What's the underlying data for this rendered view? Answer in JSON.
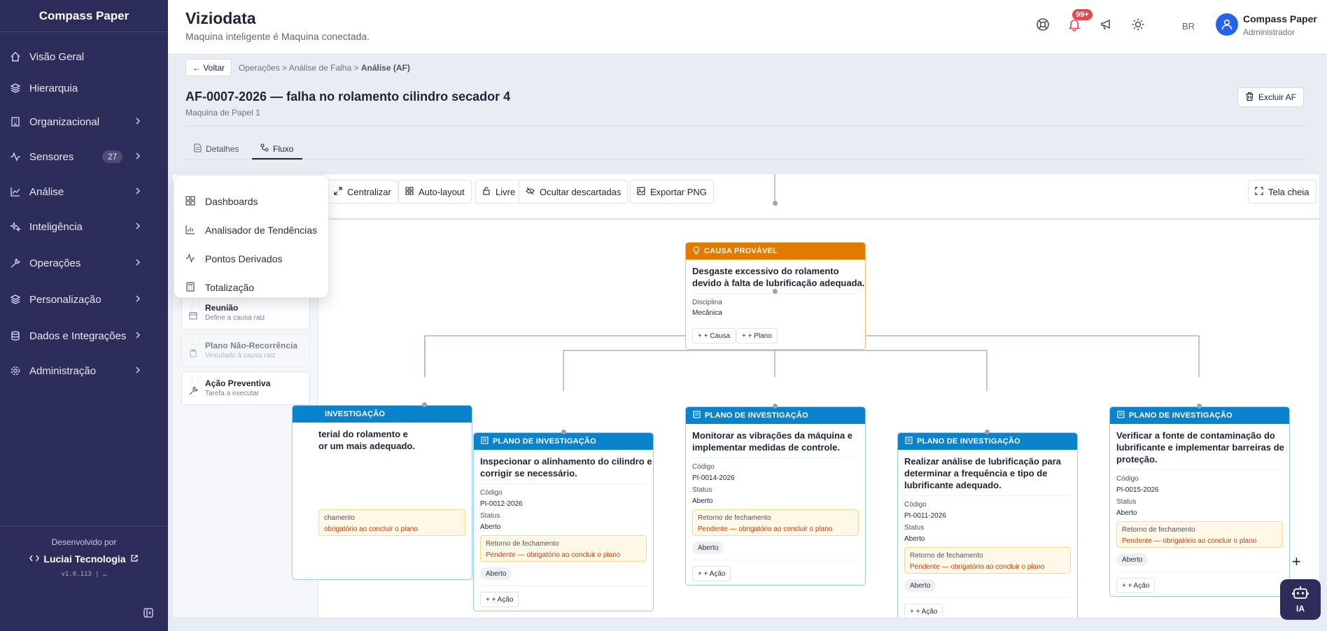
{
  "sidebar": {
    "brand": "Compass Paper",
    "items": [
      {
        "label": "Visão Geral",
        "icon": "home-icon"
      },
      {
        "label": "Hierarquia",
        "icon": "layers-icon"
      },
      {
        "label": "Organizacional",
        "icon": "building-icon"
      },
      {
        "label": "Sensores",
        "icon": "activity-icon",
        "badge": "27"
      },
      {
        "label": "Análise",
        "icon": "chart-icon"
      },
      {
        "label": "Inteligência",
        "icon": "sparkles-icon"
      },
      {
        "label": "Operações",
        "icon": "wrench-icon"
      },
      {
        "label": "Personalização",
        "icon": "layers-icon"
      },
      {
        "label": "Dados e Integrações",
        "icon": "database-icon"
      },
      {
        "label": "Administração",
        "icon": "gear-icon"
      }
    ],
    "footer": {
      "developed_by": "Desenvolvido por",
      "company": "Luciai Tecnologia",
      "version": "v1.0.113 | …"
    }
  },
  "header": {
    "title": "Viziodata",
    "subtitle": "Maquina inteligente é Maquina conectada.",
    "notifications_badge": "99+",
    "language": "BR",
    "user_name": "Compass Paper",
    "user_role": "Administrador"
  },
  "page": {
    "back_label": "← Voltar",
    "breadcrumb": {
      "part1": "Operações",
      "sep1": ">",
      "part2": "Análise de Falha",
      "sep2": ">",
      "current": "Análise (AF)"
    },
    "title": "AF-0007-2026 — falha no rolamento cilindro secador 4",
    "subtitle": "Maquina de Papel 1",
    "delete_label": "Excluir AF",
    "tabs": [
      {
        "label": "Detalhes"
      },
      {
        "label": "Fluxo"
      }
    ]
  },
  "toolbar": {
    "center": "Centralizar",
    "autolayout": "Auto-layout",
    "free": "Livre",
    "hide_discarded": "Ocultar descartadas",
    "export": "Exportar PNG",
    "fullscreen": "Tela cheia"
  },
  "dropdown": {
    "items": [
      {
        "label": "Dashboards",
        "icon": "grid-icon"
      },
      {
        "label": "Analisador de Tendências",
        "icon": "bar-chart-icon"
      },
      {
        "label": "Pontos Derivados",
        "icon": "activity-icon"
      },
      {
        "label": "Totalização",
        "icon": "calculator-icon"
      }
    ]
  },
  "palette": {
    "items": [
      {
        "title": "Reunião",
        "subtitle": "Define a causa raiz"
      },
      {
        "title": "Plano Não-Recorrência",
        "subtitle": "Vinculado à causa raiz"
      },
      {
        "title": "Ação Preventiva",
        "subtitle": "Tarefa a executar"
      }
    ]
  },
  "cause_node": {
    "header": "CAUSA PROVÁVEL",
    "title_line1": "Desgaste excessivo do rolamento",
    "title_line2": "devido à falta de lubrificação adequada.",
    "discipline_label": "Disciplina",
    "discipline_value": "Mecânica",
    "add_cause": "+ + Causa",
    "add_plan": "+ + Plano"
  },
  "plan_common": {
    "header": "PLANO DE INVESTIGAÇÃO",
    "header_partial": "INVESTIGAÇÃO",
    "code_label": "Código",
    "status_label": "Status",
    "return_label": "Retorno de fechamento",
    "pending_text": "Pendente — obrigatório ao concluir o plano",
    "pending_partial": "obrigatório ao concluir o plano",
    "return_partial": "chamento",
    "add_action": "+ + Ação"
  },
  "plans": [
    {
      "line1": "terial do rolamento e",
      "line2": "or um mais adequado."
    },
    {
      "line1": "Inspecionar o alinhamento do cilindro e",
      "line2": "corrigir se necessário.",
      "code": "PI-0012-2026",
      "status": "Aberto",
      "chip": "Aberto"
    },
    {
      "line1": "Monitorar as vibrações da máquina e",
      "line2": "implementar medidas de controle.",
      "code": "PI-0014-2026",
      "status": "Aberto",
      "chip": "Aberto"
    },
    {
      "line1": "Realizar análise de lubrificação para",
      "line2": "determinar a frequência e tipo de",
      "line3": "lubrificante adequado.",
      "code": "PI-0011-2026",
      "status": "Aberto",
      "chip": "Aberto"
    },
    {
      "line1": "Verificar a fonte de contaminação do",
      "line2": "lubrificante e implementar barreiras de",
      "line3": "proteção.",
      "code": "PI-0015-2026",
      "status": "Aberto",
      "chip": "Aberto"
    }
  ],
  "misc": {
    "ia_label": "IA",
    "zoom_in": "+"
  }
}
